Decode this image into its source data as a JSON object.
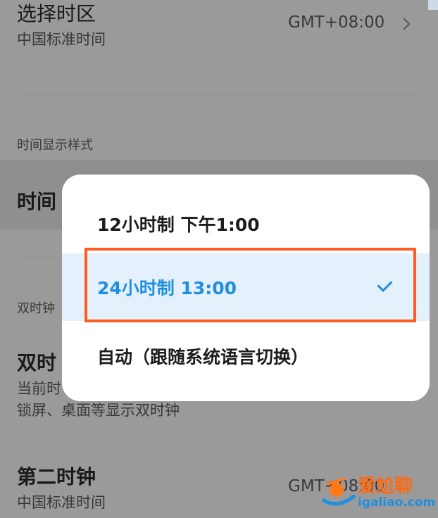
{
  "settings": {
    "timezone": {
      "title": "选择时区",
      "subtitle": "中国标准时间",
      "value": "GMT+08:00"
    },
    "section_time_display": "时间显示样式",
    "time_format_row": {
      "title": "时间"
    },
    "section_dual_clock": "双时钟",
    "dual_clock": {
      "title": "双时",
      "subtitle_line1": "当前时",
      "subtitle_line2": "锁屏、桌面等显示双时钟"
    },
    "second_clock": {
      "title": "第二时钟",
      "subtitle": "中国标准时间",
      "value": "GMT+08:00"
    }
  },
  "dialog": {
    "options": [
      {
        "label": "12小时制 下午1:00",
        "selected": false
      },
      {
        "label": "24小时制 13:00",
        "selected": true
      },
      {
        "label": "自动（跟随系统语言切换）",
        "selected": false
      }
    ]
  },
  "watermark": {
    "text": "爱尬聊",
    "url": "igaliao.com"
  },
  "colors": {
    "accent": "#1f8fe0",
    "highlight": "#ff5a1f"
  }
}
